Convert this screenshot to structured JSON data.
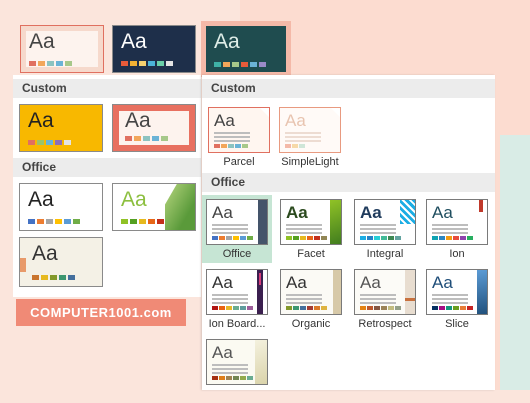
{
  "back_gallery": {
    "custom_header": "Custom",
    "office_header": "Office",
    "sample_text": "Aa"
  },
  "dropdown": {
    "custom_header": "Custom",
    "office_header": "Office",
    "sample_text": "Aa",
    "custom_themes": [
      {
        "label": "Parcel"
      },
      {
        "label": "SimpleLight"
      }
    ],
    "office_themes": [
      {
        "label": "Office",
        "selected": true
      },
      {
        "label": "Facet"
      },
      {
        "label": "Integral"
      },
      {
        "label": "Ion"
      },
      {
        "label": "Ion Board..."
      },
      {
        "label": "Organic"
      },
      {
        "label": "Retrospect"
      },
      {
        "label": "Slice"
      },
      {
        "label": ""
      }
    ]
  },
  "watermark": {
    "text": "COMPUTER1001.com"
  },
  "colors": {
    "selected_bg": "#c6e5d4",
    "header_bg": "#ececec",
    "watermark_bg": "#f08a76"
  }
}
